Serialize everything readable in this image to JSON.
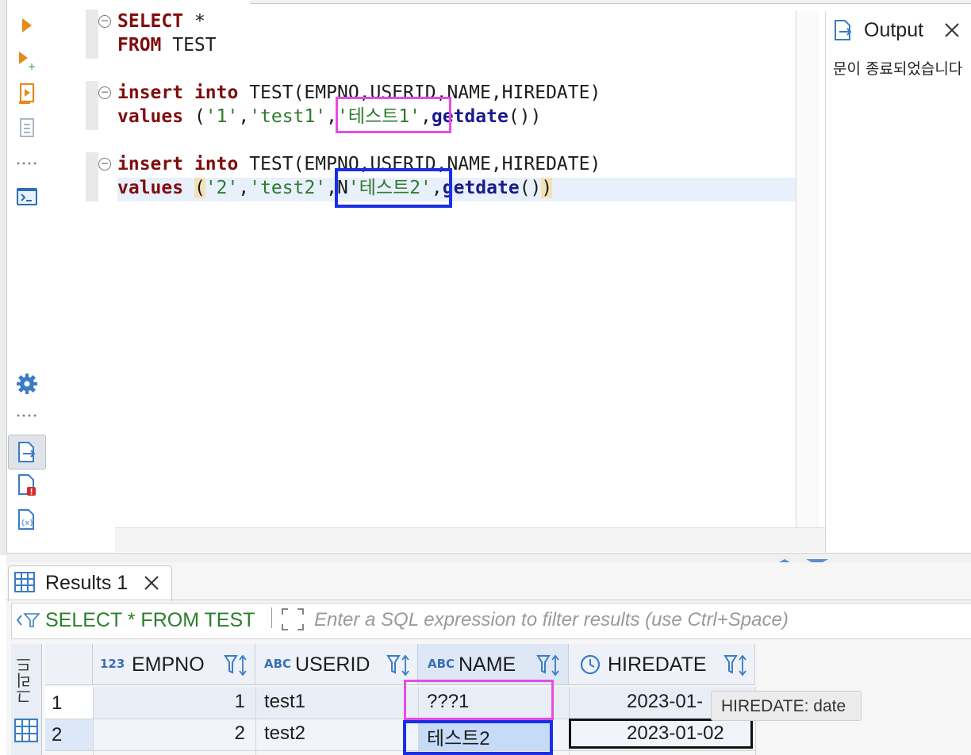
{
  "editor": {
    "lines": {
      "l1_kw": "SELECT",
      "l1_rest": " *",
      "l2_kw": "FROM",
      "l2_rest": " TEST",
      "l3_kw1": "insert",
      "l3_kw2": "into",
      "l3_rest": " TEST(EMPNO,USERID,NAME,HIREDATE)",
      "l4_kw": "values",
      "l4_open": " (",
      "l4_s1": "'1'",
      "l4_c1": ",",
      "l4_s2": "'test1'",
      "l4_c2": ",",
      "l4_s3": "'테스트1'",
      "l4_c3": ",",
      "l4_fn": "getdate",
      "l4_close": "())",
      "l5_kw1": "insert",
      "l5_kw2": "into",
      "l5_rest": " TEST(EMPNO,USERID,NAME,HIREDATE)",
      "l6_kw": "values",
      "l6_open": "(",
      "l6_s1": "'2'",
      "l6_c1": ",",
      "l6_s2": "'test2'",
      "l6_c2": ",",
      "l6_n": "N",
      "l6_s3": "'테스트2'",
      "l6_c3": ",",
      "l6_fn": "getdate",
      "l6_parens": "()",
      "l6_close": ")"
    }
  },
  "output": {
    "tab_label": "Output",
    "message": "문이  종료되었습니다"
  },
  "results": {
    "tab_label": "Results 1",
    "filter_query": "SELECT * FROM TEST",
    "filter_placeholder": "Enter a SQL expression to filter results (use Ctrl+Space)",
    "side_label": "그리드",
    "columns": [
      {
        "type": "123",
        "name": "EMPNO"
      },
      {
        "type": "ABC",
        "name": "USERID"
      },
      {
        "type": "ABC",
        "name": "NAME"
      },
      {
        "type": "clock",
        "name": "HIREDATE"
      }
    ],
    "rows": [
      {
        "num": "1",
        "empno": "1",
        "userid": "test1",
        "name": "???1",
        "hiredate": "2023-01-"
      },
      {
        "num": "2",
        "empno": "2",
        "userid": "test2",
        "name": "테스트2",
        "hiredate": "2023-01-02"
      }
    ],
    "tooltip": "HIREDATE: date"
  },
  "colors": {
    "pink_highlight": "#e64be6",
    "blue_highlight": "#1a2fe6",
    "keyword": "#7f0d0d",
    "string": "#2d7a2d",
    "function": "#1a1a8c"
  }
}
